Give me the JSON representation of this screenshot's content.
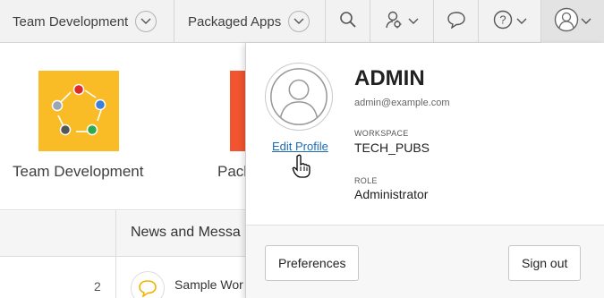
{
  "topbar": {
    "apps": [
      {
        "label": "Team Development"
      },
      {
        "label": "Packaged Apps"
      }
    ],
    "icons": [
      "search-icon",
      "user-settings-icon",
      "chevron-down-icon",
      "chat-bubble-icon",
      "help-icon",
      "chevron-down-icon",
      "avatar-icon",
      "chevron-down-icon"
    ]
  },
  "page": {
    "apps": [
      {
        "name": "Team Development",
        "color": "#f9bc26"
      },
      {
        "name": "Pack",
        "color": "#f1542f"
      }
    ],
    "news_header": "News and Messa",
    "row_count": "2",
    "message_text": "Sample Wor"
  },
  "profile_popup": {
    "name": "ADMIN",
    "email": "admin@example.com",
    "edit_profile_label": "Edit Profile",
    "workspace_label": "WORKSPACE",
    "workspace_value": "TECH_PUBS",
    "role_label": "ROLE",
    "role_value": "Administrator",
    "preferences_label": "Preferences",
    "sign_out_label": "Sign out"
  },
  "colors": {
    "link": "#1a6cb4",
    "topbar_bg": "#f2f2f2",
    "tile_yellow": "#f9bc26",
    "tile_red": "#f1542f"
  }
}
